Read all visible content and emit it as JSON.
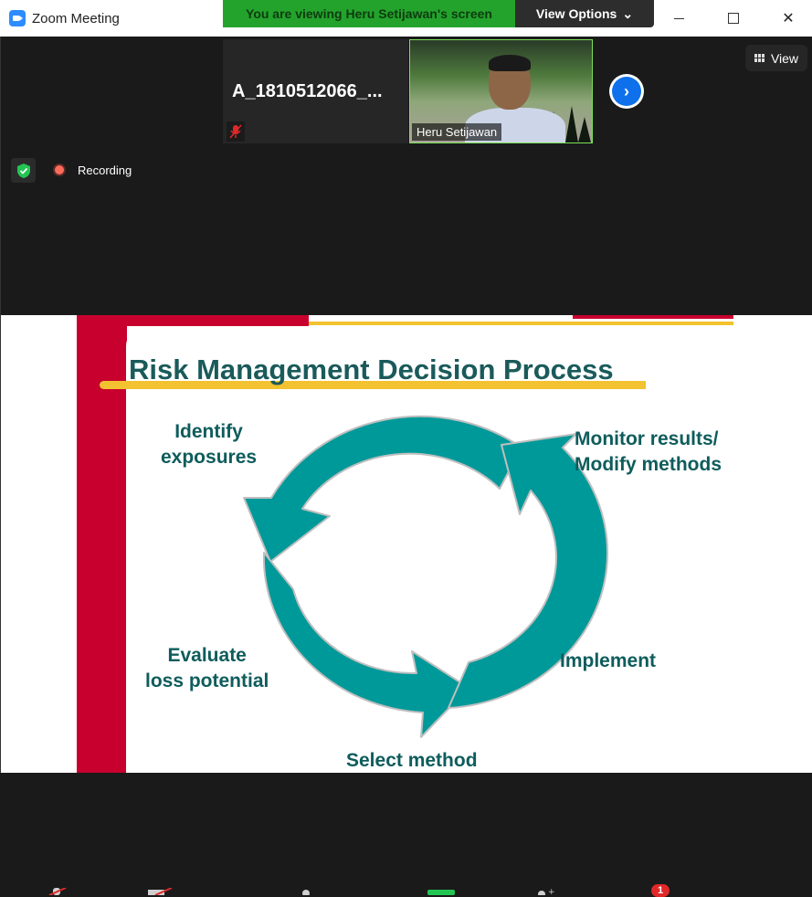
{
  "window": {
    "title": "Zoom Meeting",
    "controls": {
      "minimize": "minimize-icon",
      "maximize": "maximize-icon",
      "close": "close-icon"
    }
  },
  "share_banner": {
    "text": "You are viewing Heru Setijawan's screen",
    "view_options_label": "View Options",
    "color": "#23a32c"
  },
  "participants": [
    {
      "display": "A_1810512066_...",
      "muted": true
    },
    {
      "display": "Heru Setijawan",
      "video": true
    }
  ],
  "view_button": {
    "label": "View"
  },
  "status": {
    "recording_label": "Recording"
  },
  "slide": {
    "title": "Risk Management Decision Process",
    "labels": {
      "identify": [
        "Identify",
        "exposures"
      ],
      "monitor": [
        "Monitor results/",
        "Modify methods"
      ],
      "evaluate": [
        "Evaluate",
        "loss potential"
      ],
      "implement": "Implement",
      "select": "Select method"
    },
    "colors": {
      "accent_red": "#c8002e",
      "gold": "#f2c230",
      "teal": "#00999a",
      "title": "#1a5a5a"
    }
  },
  "toolbar": {
    "notification_badge": "1"
  }
}
